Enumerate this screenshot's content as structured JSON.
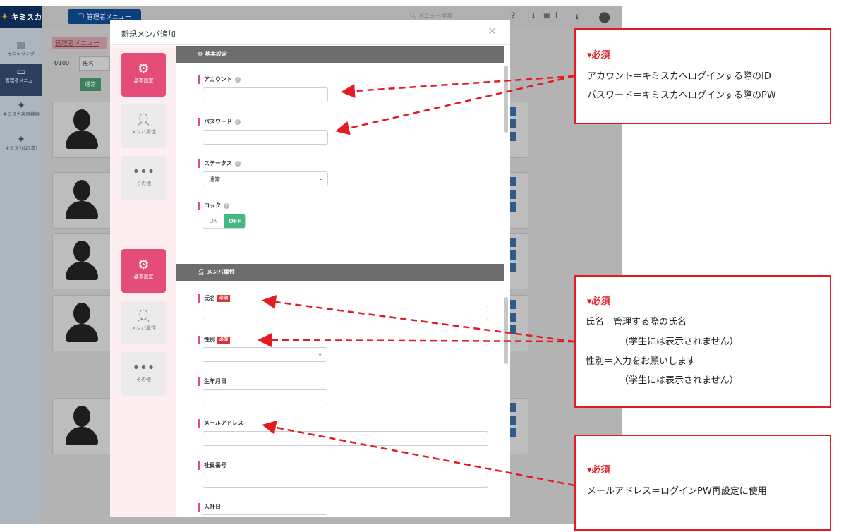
{
  "app": {
    "logo_text": "キミスカ",
    "admin_menu_label": "管理者メニュー",
    "search_placeholder": "メニュー検索",
    "sidebar": [
      {
        "label": "モニタリング",
        "icon": "chart-icon"
      },
      {
        "label": "管理者メニュー",
        "icon": "monitor-icon"
      },
      {
        "label": "キミスカ高度検索",
        "icon": "star-icon"
      },
      {
        "label": "キミスカ(27卒)",
        "icon": "star-icon"
      }
    ],
    "breadcrumb_link": "管理者メニュー",
    "member_count": "4/100",
    "name_filter": "氏名",
    "status_button": "通常"
  },
  "modal": {
    "title": "新規メンバ追加",
    "close_label": "×",
    "nav": [
      {
        "label": "基本設定",
        "icon": "gear-icon"
      },
      {
        "label": "メンバ属性",
        "icon": "person-icon"
      },
      {
        "label": "その他",
        "icon": "more-icon"
      }
    ],
    "basic_section_title": "基本設定",
    "member_section_title": "メンバ属性",
    "fields": {
      "account": "アカウント",
      "password": "パスワード",
      "status": "ステータス",
      "status_value": "通常",
      "lock": "ロック",
      "lock_on": "ON",
      "lock_off": "OFF",
      "name": "氏名",
      "gender": "性別",
      "birthdate": "生年月日",
      "email": "メールアドレス",
      "employee_no": "社員番号",
      "join_date": "入社日",
      "required_badge": "必須"
    }
  },
  "callouts": [
    {
      "title": "▾必須",
      "lines": [
        "アカウント＝キミスカへログインする際のID",
        "パスワード＝キミスカへログインする際のPW"
      ]
    },
    {
      "title": "▾必須",
      "lines": [
        "氏名＝管理する際の氏名",
        "（学生には表示されません）",
        "性別＝入力をお願いします",
        "（学生には表示されません）"
      ]
    },
    {
      "title": "▾必須",
      "lines": [
        "メールアドレス＝ログインPW再設定に使用"
      ]
    }
  ],
  "colors": {
    "accent_pink": "#e44d78",
    "callout_red": "#e31b24",
    "toggle_green": "#43b97f",
    "section_gray": "#6d6d6d"
  }
}
